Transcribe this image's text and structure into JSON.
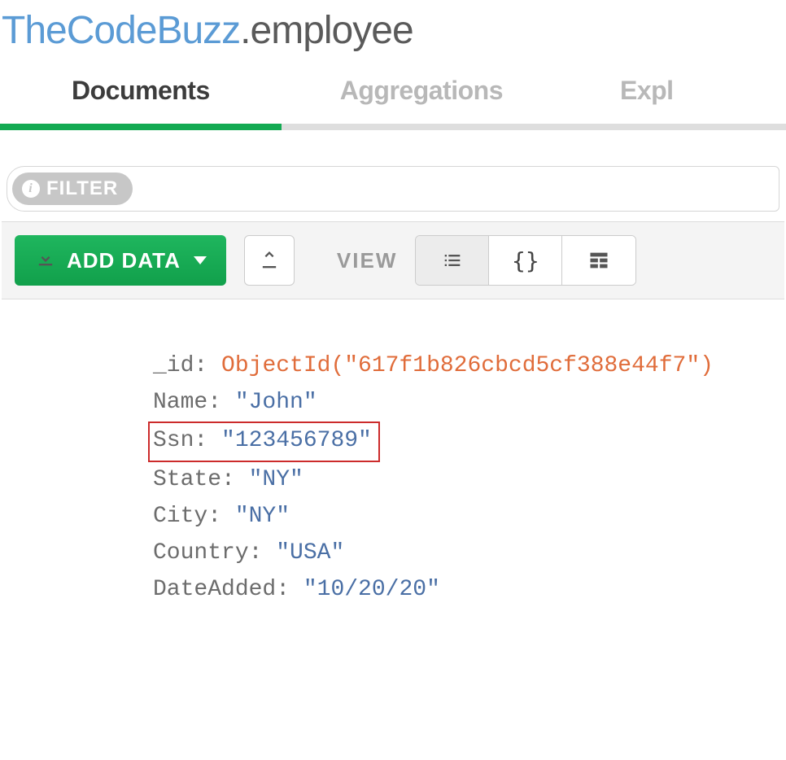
{
  "header": {
    "database": "TheCodeBuzz",
    "collection": "employee"
  },
  "tabs": [
    {
      "label": "Documents",
      "active": true
    },
    {
      "label": "Aggregations",
      "active": false
    },
    {
      "label": "Expl",
      "active": false
    }
  ],
  "filter": {
    "label": "FILTER"
  },
  "toolbar": {
    "add_data_label": "ADD DATA",
    "view_label": "VIEW"
  },
  "document": {
    "fields": [
      {
        "key": "_id",
        "type": "objectid",
        "value": "ObjectId(\"617f1b826cbcd5cf388e44f7\")",
        "highlight": false
      },
      {
        "key": "Name",
        "type": "string",
        "value": "\"John\"",
        "highlight": false
      },
      {
        "key": "Ssn",
        "type": "string",
        "value": "\"123456789\"",
        "highlight": true
      },
      {
        "key": "State",
        "type": "string",
        "value": "\"NY\"",
        "highlight": false
      },
      {
        "key": "City",
        "type": "string",
        "value": "\"NY\"",
        "highlight": false
      },
      {
        "key": "Country",
        "type": "string",
        "value": "\"USA\"",
        "highlight": false
      },
      {
        "key": "DateAdded",
        "type": "string",
        "value": "\"10/20/20\"",
        "highlight": false
      }
    ]
  }
}
